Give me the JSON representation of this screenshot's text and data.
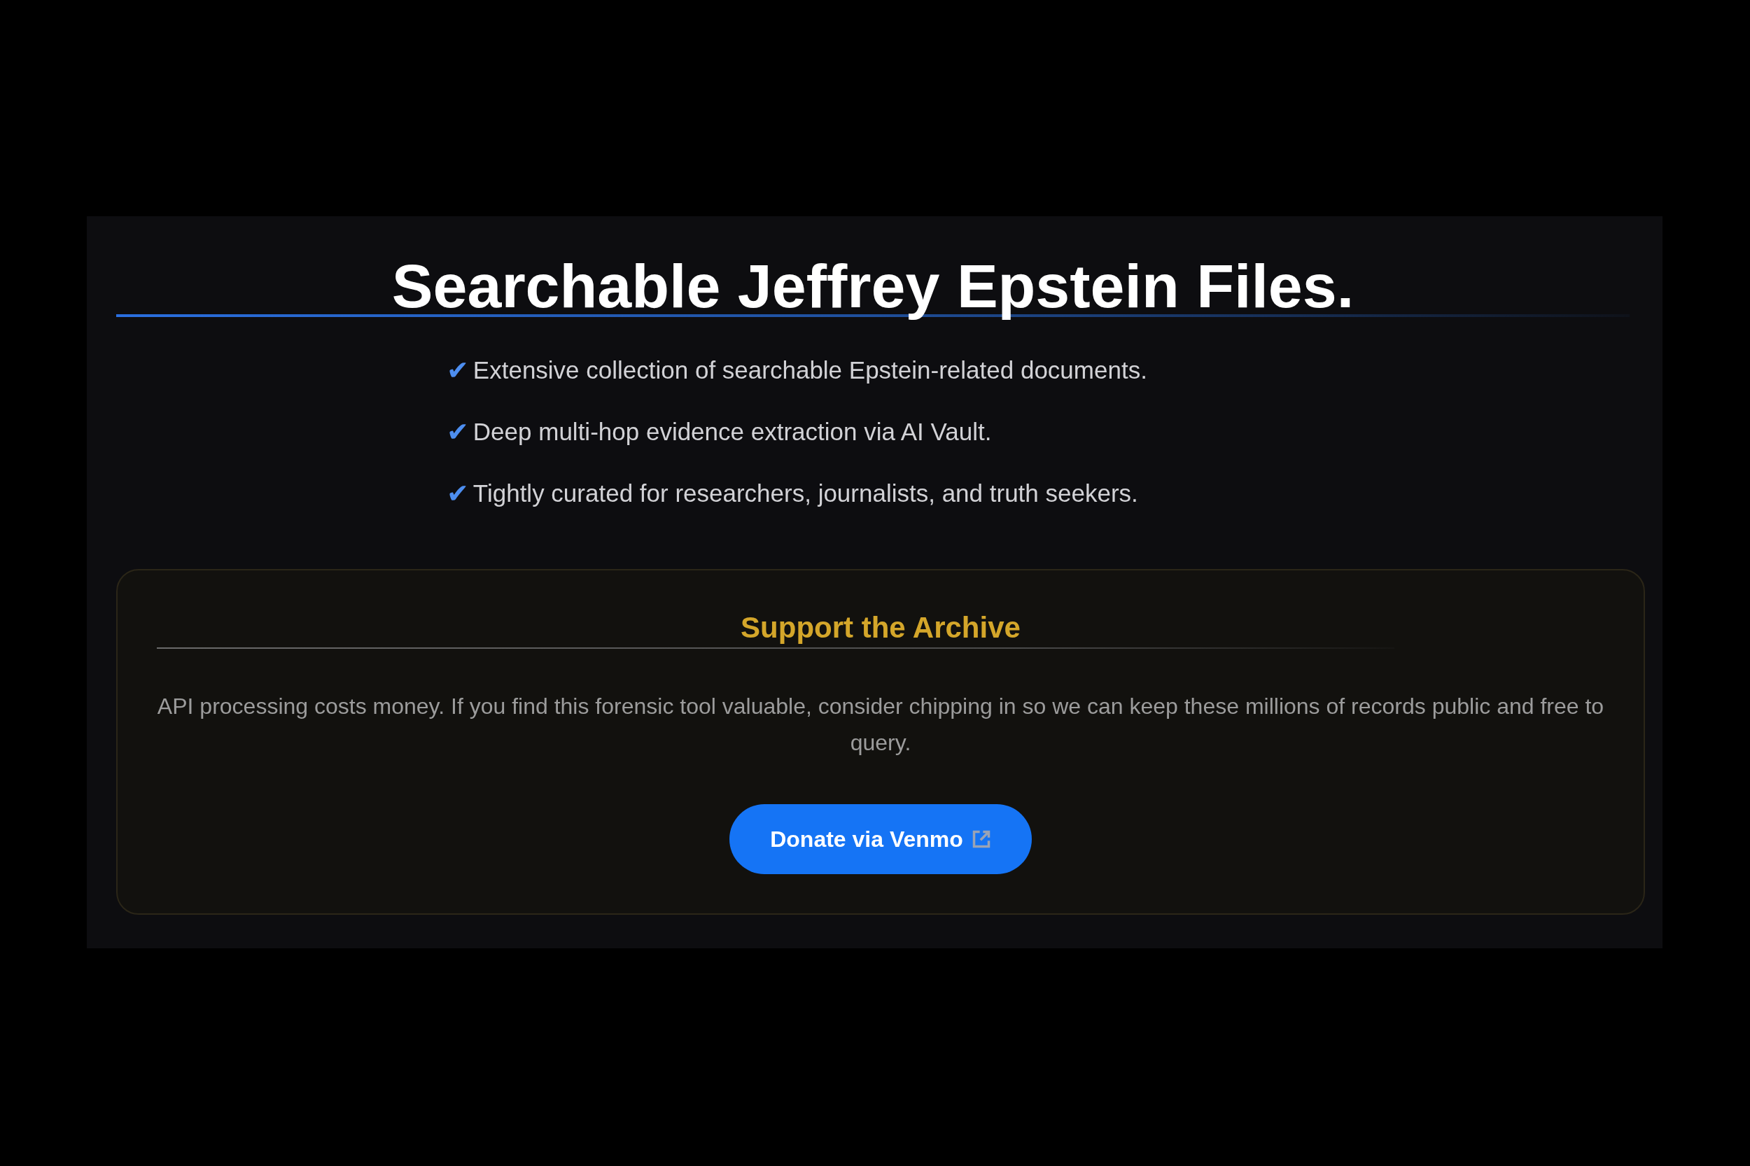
{
  "title": "Searchable Jeffrey Epstein Files.",
  "features": [
    {
      "mark": "✔",
      "text": "Extensive collection of searchable Epstein-related documents."
    },
    {
      "mark": "✔",
      "text": "Deep multi-hop evidence extraction via AI Vault."
    },
    {
      "mark": "✔",
      "text": "Tightly curated for researchers, journalists, and truth seekers."
    }
  ],
  "support": {
    "heading": "Support the Archive",
    "text": "API processing costs money. If you find this forensic tool valuable, consider chipping in so we can keep these millions of records public and free to query.",
    "button": {
      "label": "Donate via Venmo"
    }
  }
}
